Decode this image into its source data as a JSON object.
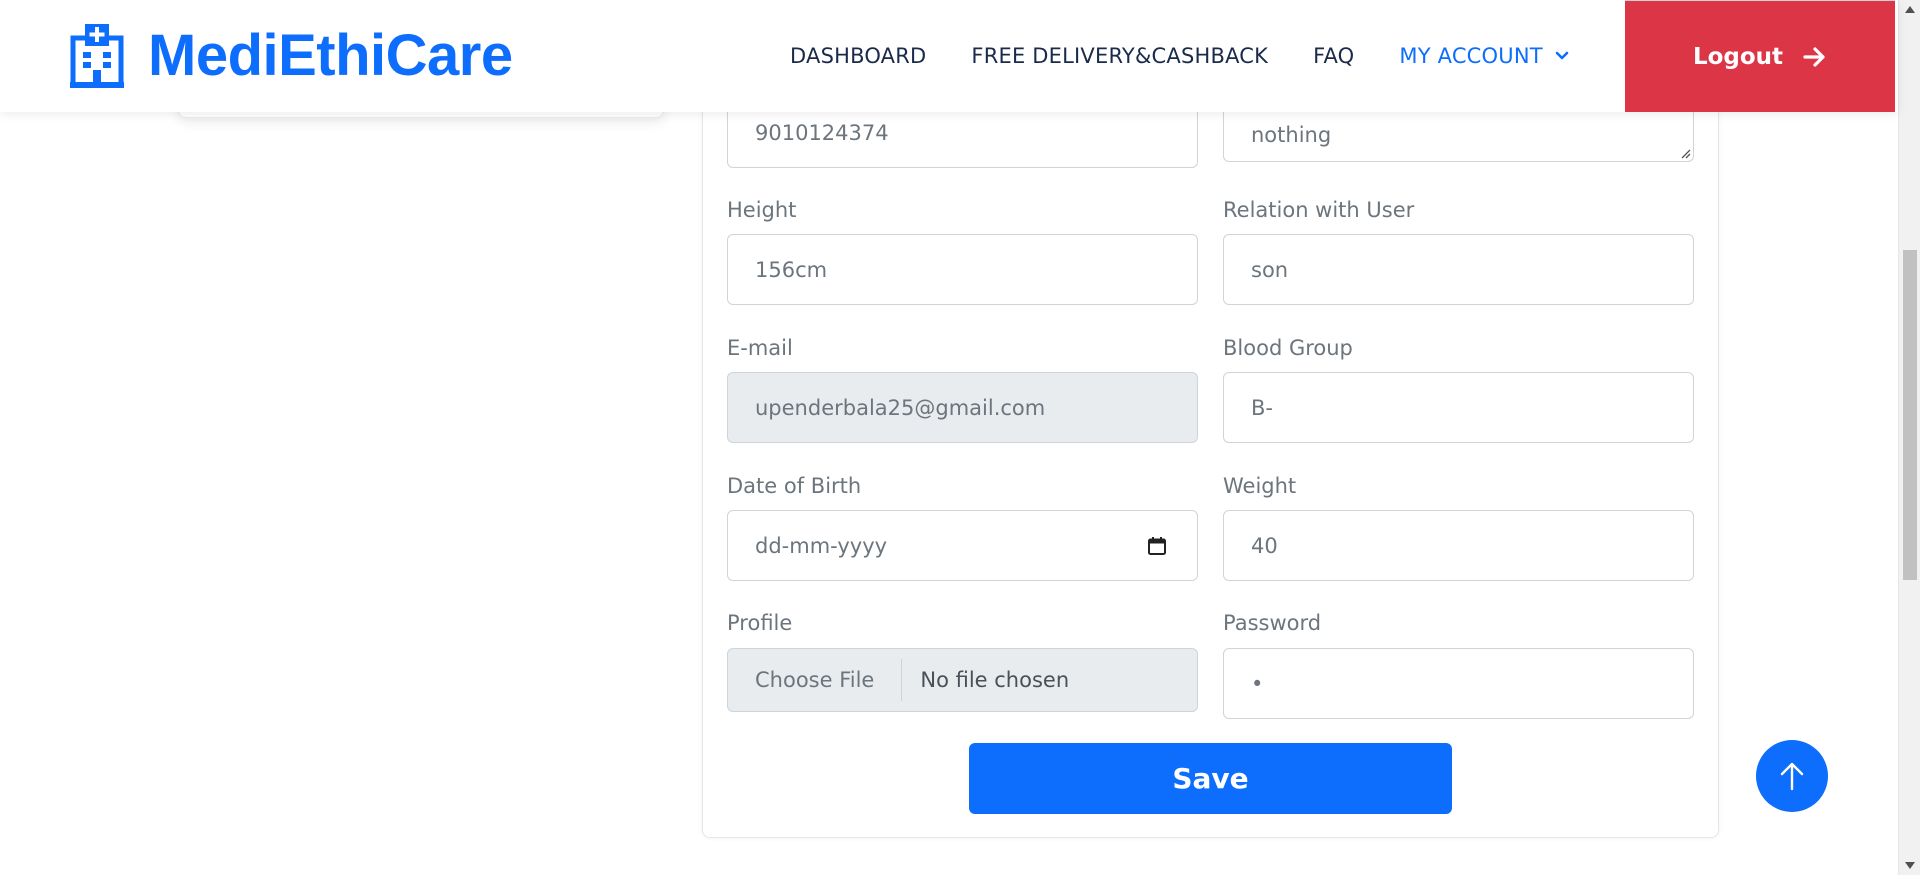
{
  "brand": {
    "name": "MediEthiCare",
    "icon": "hospital-icon",
    "color": "#0d6efd"
  },
  "nav": {
    "links": [
      "DASHBOARD",
      "FREE DELIVERY&CASHBACK",
      "FAQ"
    ],
    "account": "MY ACCOUNT",
    "logout": "Logout"
  },
  "form": {
    "phone_value": "9010124374",
    "notes_value": "nothing",
    "height": {
      "label": "Height",
      "value": "156cm"
    },
    "relation": {
      "label": "Relation with User",
      "value": "son"
    },
    "email": {
      "label": "E-mail",
      "value": "upenderbala25@gmail.com"
    },
    "blood_group": {
      "label": "Blood Group",
      "value": "B-"
    },
    "dob": {
      "label": "Date of Birth",
      "value": "dd-mm-yyyy"
    },
    "weight": {
      "label": "Weight",
      "value": "40"
    },
    "profile": {
      "label": "Profile",
      "button": "Choose File",
      "status": "No file chosen"
    },
    "password": {
      "label": "Password",
      "value": "•"
    },
    "save": "Save"
  },
  "colors": {
    "primary": "#0d6efd",
    "danger": "#dc3545"
  }
}
